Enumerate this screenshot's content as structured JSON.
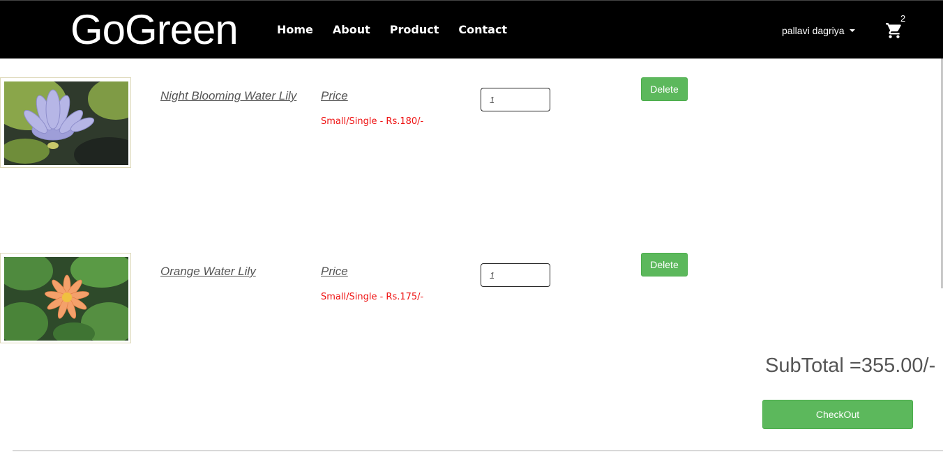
{
  "navbar": {
    "brand": "GoGreen",
    "links": [
      "Home",
      "About",
      "Product",
      "Contact"
    ],
    "user_name": "pallavi dagriya",
    "cart_count": "2"
  },
  "cart_items": [
    {
      "name": "Night Blooming Water Lily",
      "price_label": "Price",
      "price_text": "Small/Single - Rs.180/-",
      "quantity": "1",
      "delete_label": "Delete"
    },
    {
      "name": "Orange Water Lily",
      "price_label": "Price",
      "price_text": "Small/Single - Rs.175/-",
      "quantity": "1",
      "delete_label": "Delete"
    }
  ],
  "summary": {
    "subtotal": "SubTotal =355.00/-",
    "checkout_label": "CheckOut"
  },
  "colors": {
    "navbar_bg": "#000000",
    "button_green": "#5cb85c",
    "price_red": "#ee1111"
  },
  "icons": [
    "cart-icon",
    "caret-down-icon"
  ]
}
